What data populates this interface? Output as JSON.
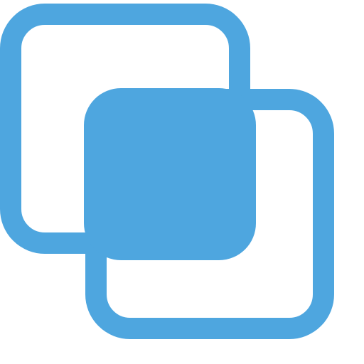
{
  "icon": {
    "name": "overlapping-squares-icon",
    "colors": {
      "primary": "#4EA6DF",
      "outline": "#3E8FC8",
      "background": "#FFFFFF"
    }
  }
}
